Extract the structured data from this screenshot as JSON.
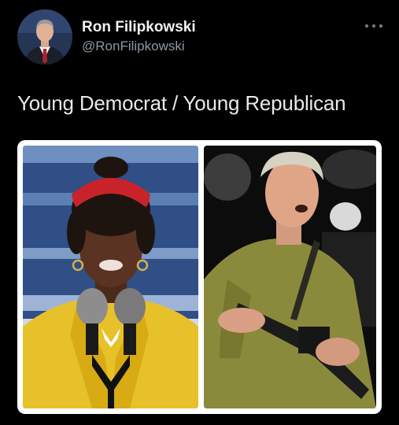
{
  "author": {
    "display_name": "Ron Filipkowski",
    "handle": "@RonFilipkowski",
    "avatar_icon": "profile-photo"
  },
  "tweet": {
    "text": "Young Democrat / Young Republican",
    "more_icon": "more-dots-icon"
  },
  "media": {
    "photos": [
      {
        "subject": "speaker-at-microphones"
      },
      {
        "subject": "man-with-rifle"
      }
    ]
  },
  "colors": {
    "background": "#000000",
    "text_primary": "#e7e9ea",
    "text_secondary": "#8b98a5",
    "media_border": "#ffffff"
  }
}
